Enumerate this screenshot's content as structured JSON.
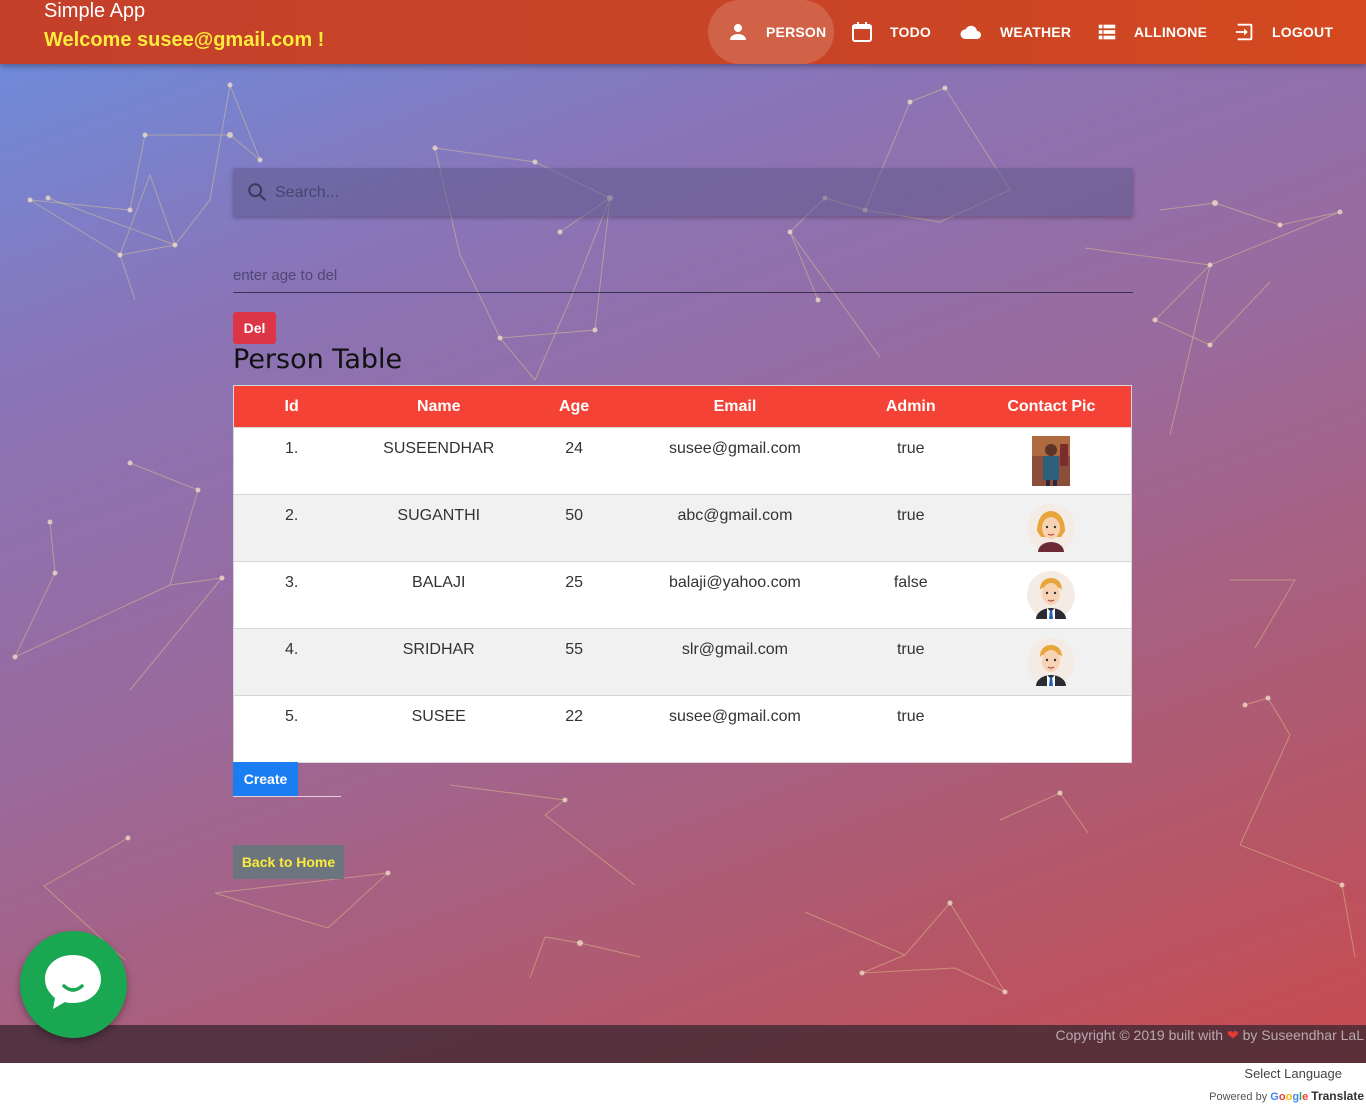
{
  "app": {
    "title": "Simple App",
    "welcome": "Welcome susee@gmail.com !"
  },
  "nav": {
    "items": [
      {
        "label": "PERSON",
        "icon": "person-icon",
        "active": true
      },
      {
        "label": "TODO",
        "icon": "calendar-icon",
        "active": false
      },
      {
        "label": "WEATHER",
        "icon": "cloud-icon",
        "active": false
      },
      {
        "label": "ALLINONE",
        "icon": "list-icon",
        "active": false
      },
      {
        "label": "LOGOUT",
        "icon": "logout-icon",
        "active": false
      }
    ]
  },
  "search": {
    "placeholder": "Search..."
  },
  "delete": {
    "age_placeholder": "enter age to del",
    "button_label": "Del"
  },
  "table": {
    "title": "Person Table",
    "columns": [
      "Id",
      "Name",
      "Age",
      "Email",
      "Admin",
      "Contact Pic"
    ],
    "rows": [
      {
        "id": "1.",
        "name": "SUSEENDHAR",
        "age": "24",
        "email": "susee@gmail.com",
        "admin": "true",
        "pic": "photo"
      },
      {
        "id": "2.",
        "name": "SUGANTHI",
        "age": "50",
        "email": "abc@gmail.com",
        "admin": "true",
        "pic": "female-avatar"
      },
      {
        "id": "3.",
        "name": "BALAJI",
        "age": "25",
        "email": "balaji@yahoo.com",
        "admin": "false",
        "pic": "male-avatar"
      },
      {
        "id": "4.",
        "name": "SRIDHAR",
        "age": "55",
        "email": "slr@gmail.com",
        "admin": "true",
        "pic": "male-avatar"
      },
      {
        "id": "5.",
        "name": "SUSEE",
        "age": "22",
        "email": "susee@gmail.com",
        "admin": "true",
        "pic": ""
      }
    ]
  },
  "actions": {
    "create_label": "Create",
    "back_home_label": "Back to Home"
  },
  "footer": {
    "copyright_prefix": "Copyright © 2019 built with",
    "copyright_suffix": "by Suseendhar LaL"
  },
  "translate": {
    "select_language": "Select Language",
    "powered_by": "Powered by",
    "google": "Google",
    "translate": "Translate"
  },
  "colors": {
    "header": "#c94426",
    "welcome": "#ffeb3b",
    "table_header": "#f44336",
    "del_button": "#dc3545",
    "create_button": "#1a7ef2",
    "home_button": "#6c757d",
    "chat_button": "#1aa752"
  }
}
